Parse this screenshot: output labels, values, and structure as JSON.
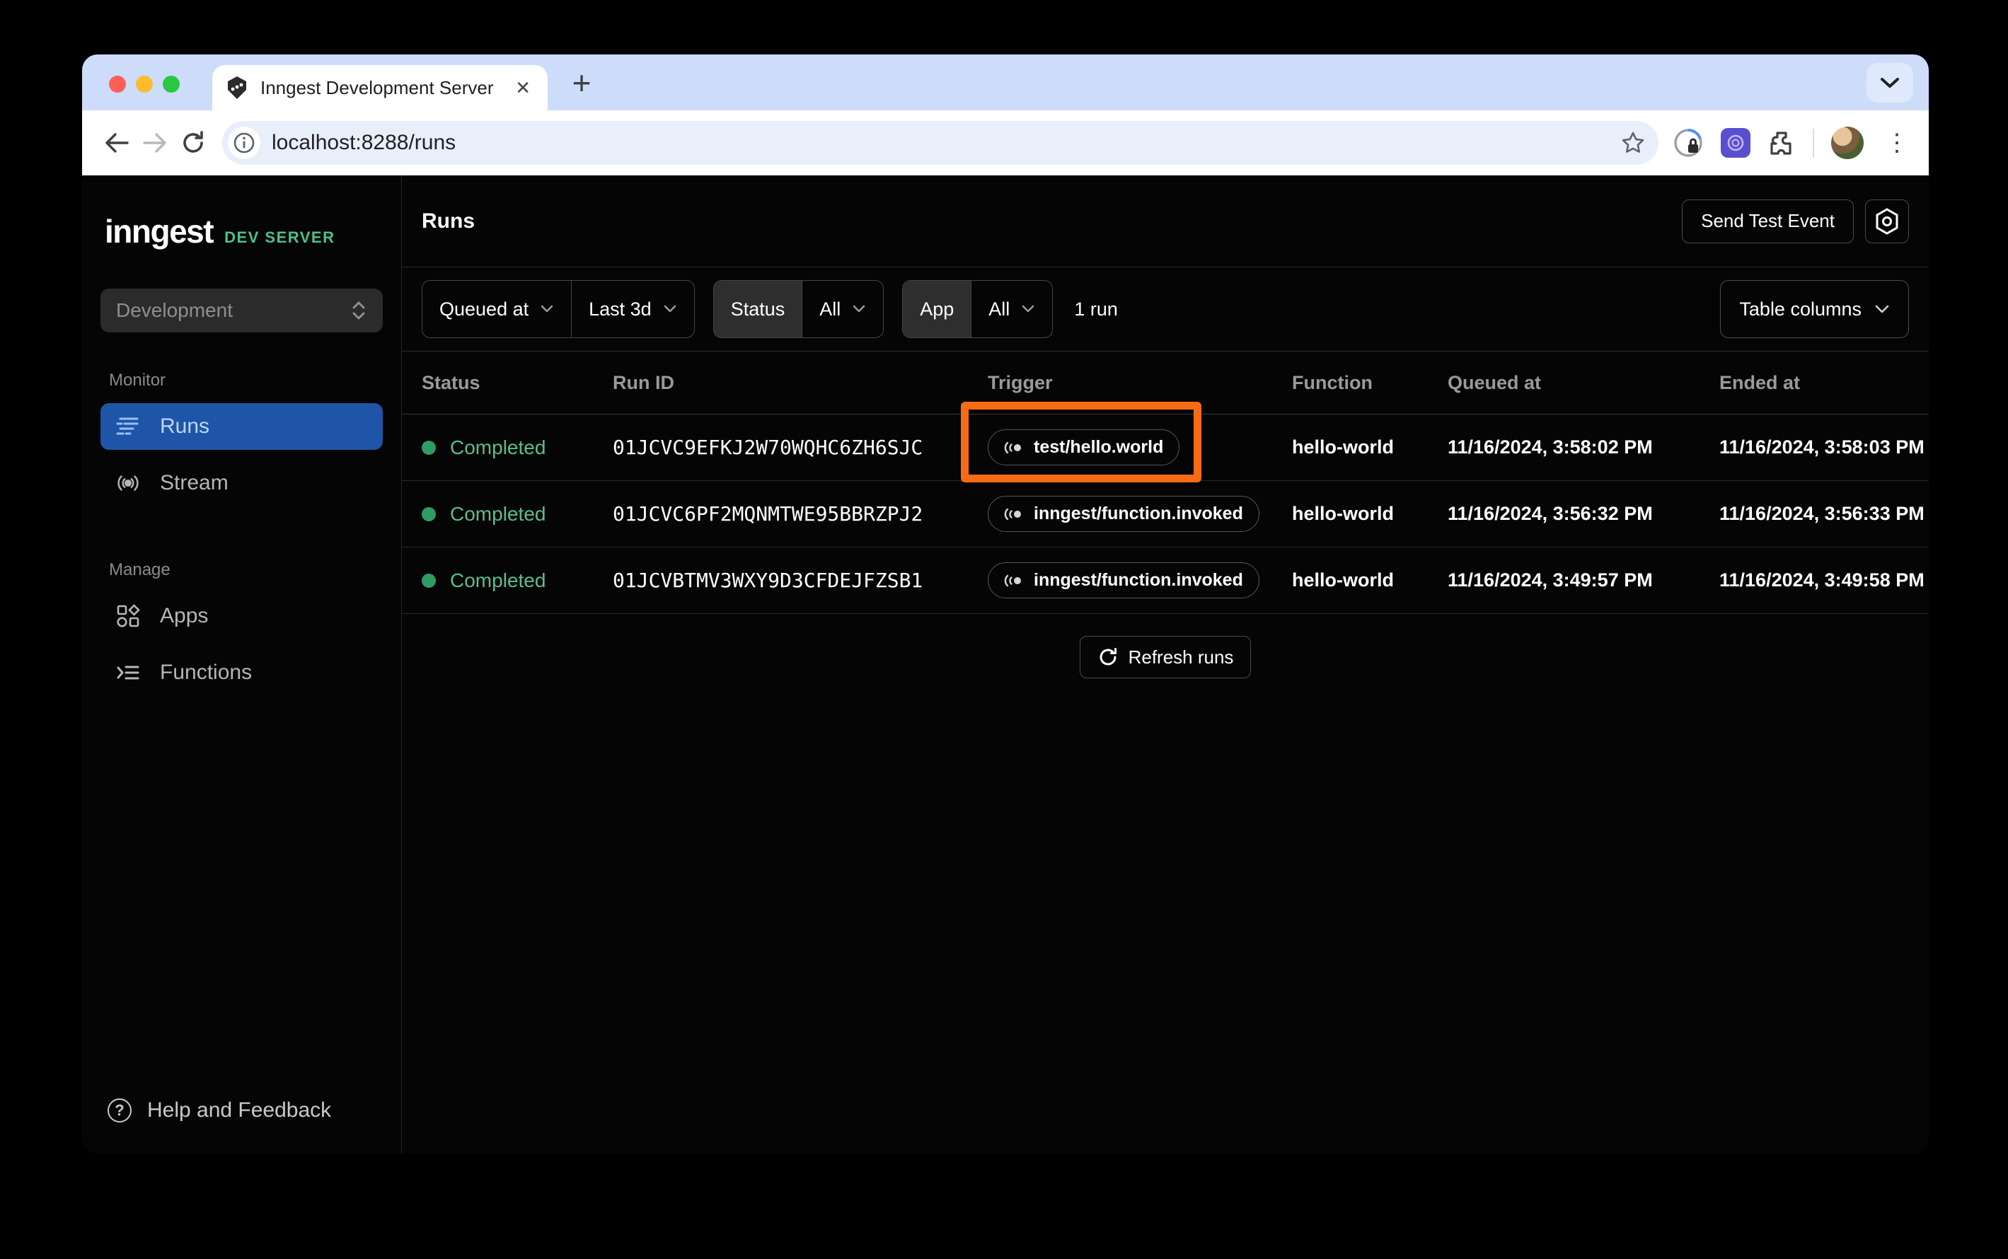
{
  "browser": {
    "tab_title": "Inngest Development Server",
    "url": "localhost:8288/runs"
  },
  "glyphs": {
    "tab_close": "✕",
    "new_tab": "+",
    "menu_dots": "⋮",
    "help": "?"
  },
  "sidebar": {
    "logo": "inngest",
    "logo_badge": "DEV SERVER",
    "env_selector": "Development",
    "sections": [
      {
        "label": "Monitor",
        "items": [
          {
            "label": "Runs",
            "icon": "runs-icon",
            "active": true
          },
          {
            "label": "Stream",
            "icon": "stream-icon",
            "active": false
          }
        ]
      },
      {
        "label": "Manage",
        "items": [
          {
            "label": "Apps",
            "icon": "apps-icon",
            "active": false
          },
          {
            "label": "Functions",
            "icon": "functions-icon",
            "active": false
          }
        ]
      }
    ],
    "help_label": "Help and Feedback"
  },
  "header": {
    "title": "Runs",
    "send_test_event_label": "Send Test Event",
    "settings_icon": "gear-hexagon-icon"
  },
  "filters": {
    "queued_at_label": "Queued at",
    "time_range_value": "Last 3d",
    "status_label": "Status",
    "status_value": "All",
    "app_label": "App",
    "app_value": "All",
    "run_count": "1 run",
    "table_columns_label": "Table columns"
  },
  "table": {
    "columns": [
      "Status",
      "Run ID",
      "Trigger",
      "Function",
      "Queued at",
      "Ended at"
    ],
    "rows": [
      {
        "status": "Completed",
        "run_id": "01JCVC9EFKJ2W70WQHC6ZH6SJC",
        "trigger": "test/hello.world",
        "function": "hello-world",
        "queued_at": "11/16/2024, 3:58:02 PM",
        "ended_at": "11/16/2024, 3:58:03 PM",
        "highlighted": true
      },
      {
        "status": "Completed",
        "run_id": "01JCVC6PF2MQNMTWE95BBRZPJ2",
        "trigger": "inngest/function.invoked",
        "function": "hello-world",
        "queued_at": "11/16/2024, 3:56:32 PM",
        "ended_at": "11/16/2024, 3:56:33 PM",
        "highlighted": false
      },
      {
        "status": "Completed",
        "run_id": "01JCVBTMV3WXY9D3CFDEJFZSB1",
        "trigger": "inngest/function.invoked",
        "function": "hello-world",
        "queued_at": "11/16/2024, 3:49:57 PM",
        "ended_at": "11/16/2024, 3:49:58 PM",
        "highlighted": false
      }
    ],
    "refresh_label": "Refresh runs"
  },
  "colors": {
    "accent_blue": "#1e55a9",
    "brand_green": "#4ec08e",
    "status_completed_text": "#5cbd8d",
    "status_completed_dot": "#2f9c63",
    "annotation_orange": "#f76b15",
    "tabstrip_blue": "#cddcf9"
  }
}
